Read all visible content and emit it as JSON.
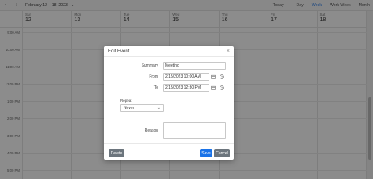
{
  "toolbar": {
    "prev": "‹",
    "next": "›",
    "date_range": "February 12 – 18, 2023",
    "views": [
      "Today",
      "Day",
      "Week",
      "Work Week",
      "Month"
    ],
    "active_view": "Week"
  },
  "days": [
    {
      "name": "Sun",
      "num": "12"
    },
    {
      "name": "Mon",
      "num": "13"
    },
    {
      "name": "Tue",
      "num": "14"
    },
    {
      "name": "Wed",
      "num": "15"
    },
    {
      "name": "Thu",
      "num": "16"
    },
    {
      "name": "Fri",
      "num": "17"
    },
    {
      "name": "Sat",
      "num": "18"
    }
  ],
  "times": [
    "9:00 AM",
    "10:00 AM",
    "11:00 AM",
    "12:00 PM",
    "1:00 PM",
    "2:00 PM",
    "3:00 PM",
    "4:00 PM",
    "5:00 PM"
  ],
  "dialog": {
    "title": "Edit Event",
    "close": "×",
    "summary_label": "Summary",
    "summary_value": "Meeting",
    "from_label": "From",
    "from_value": "2/15/2023 10:00 AM",
    "to_label": "To",
    "to_value": "2/15/2023 12:30 PM",
    "repeat_label": "Repeat",
    "repeat_value": "Never",
    "reason_label": "Reason",
    "delete_label": "Delete",
    "save_label": "Save",
    "cancel_label": "Cancel"
  },
  "colors": {
    "accent": "#1a73e8",
    "secondary_btn": "#6c757d"
  }
}
